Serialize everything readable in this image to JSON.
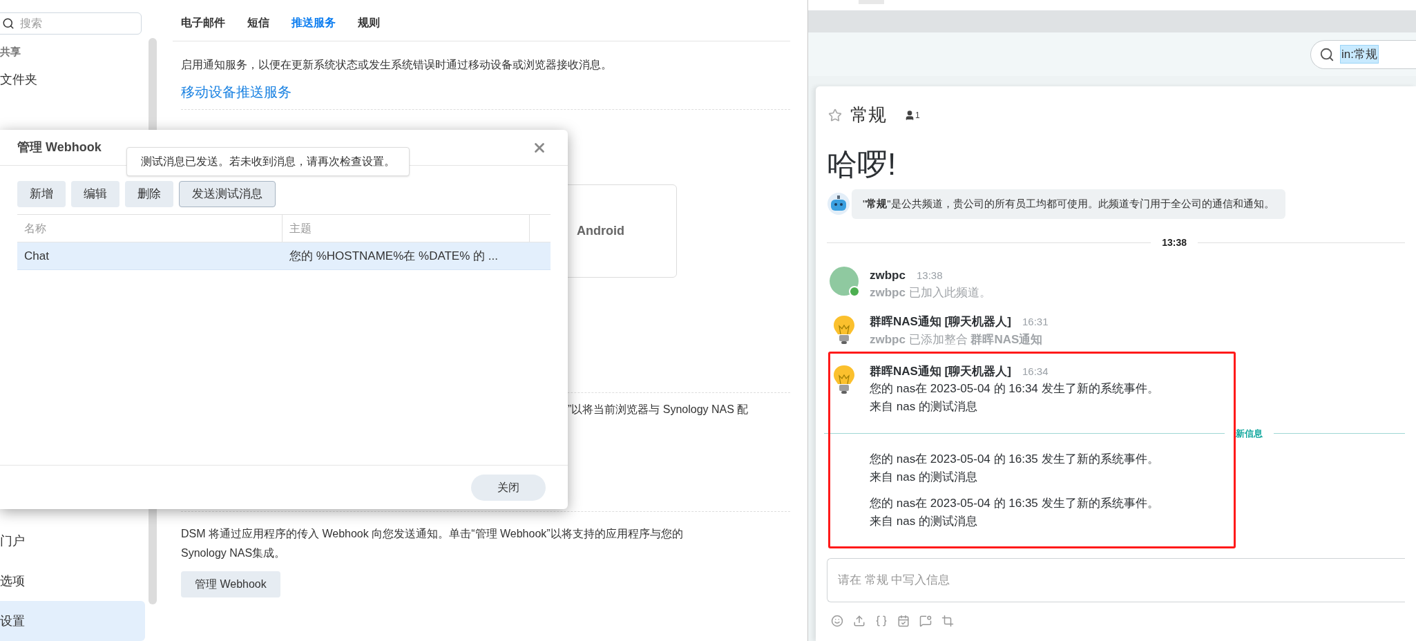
{
  "settings": {
    "search": {
      "placeholder": "搜索"
    },
    "sidebar": {
      "sections": [
        {
          "heading": "共享",
          "items": [
            {
              "label": "文件夹",
              "selected": false
            }
          ]
        },
        {
          "items": [
            {
              "label": "门户",
              "selected": false
            },
            {
              "label": "选项",
              "selected": false
            },
            {
              "label": "设置",
              "selected": true
            }
          ]
        }
      ]
    },
    "tabs": [
      {
        "label": "电子邮件",
        "selected": false
      },
      {
        "label": "短信",
        "selected": false
      },
      {
        "label": "推送服务",
        "selected": true
      },
      {
        "label": "规则",
        "selected": false
      }
    ],
    "description": "启用通知服务，以便在更新系统状态或发生系统错误时通过移动设备或浏览器接收消息。",
    "mobile_link": "移动设备推送服务",
    "android_card": "Android",
    "browser_text_fragment": "”以将当前浏览器与 Synology NAS 配",
    "webhook_text": "DSM 将通过应用程序的传入 Webhook 向您发送通知。单击“管理 Webhook”以将支持的应用程序与您的 Synology NAS集成。",
    "manage_button": "管理 Webhook"
  },
  "dialog": {
    "title": "管理 Webhook",
    "toast": "测试消息已发送。若未收到消息，请再次检查设置。",
    "toolbar": [
      {
        "label": "新增",
        "focused": false
      },
      {
        "label": "编辑",
        "focused": false
      },
      {
        "label": "删除",
        "focused": false
      },
      {
        "label": "发送测试消息",
        "focused": true
      }
    ],
    "table": {
      "columns": [
        "名称",
        "主题"
      ],
      "rows": [
        {
          "cells": [
            "Chat",
            "您的 %HOSTNAME%在 %DATE% 的 ..."
          ],
          "selected": true
        }
      ]
    },
    "close_button": "关闭"
  },
  "chat": {
    "search": {
      "value": "in:常规"
    },
    "channel": {
      "name": "常规",
      "starred": false,
      "member_count": "1"
    },
    "greeting": "哈啰!",
    "intro": "\"**常规**\"是公共频道，贵公司的所有员工均都可使用。此频道专门用于全公司的通信和通知。",
    "timeline": [
      {
        "kind": "divider",
        "label": "13:38"
      },
      {
        "kind": "message",
        "avatar": {
          "kind": "user",
          "online": true
        },
        "author": "zwbpc",
        "time": "13:38",
        "lines": [
          "**zwbpc** 已加入此频道。"
        ],
        "system": true
      },
      {
        "kind": "message",
        "avatar": {
          "kind": "bot"
        },
        "author": "群晖NAS通知 [聊天机器人]",
        "time": "16:31",
        "lines": [
          "**zwbpc** 已添加整合 **群晖NAS通知**"
        ],
        "system": true
      },
      {
        "kind": "message",
        "avatar": {
          "kind": "bot"
        },
        "author": "群晖NAS通知 [聊天机器人]",
        "time": "16:34",
        "lines": [
          "您的 nas在 2023-05-04 的 16:34 发生了新的系统事件。",
          "来自 nas 的测试消息"
        ],
        "system": false,
        "highlighted": true
      },
      {
        "kind": "new_divider",
        "label": "新信息",
        "highlighted": true
      },
      {
        "kind": "continuation",
        "lines": [
          "您的 nas在 2023-05-04 的 16:35 发生了新的系统事件。",
          "来自 nas 的测试消息"
        ],
        "highlighted": true
      },
      {
        "kind": "continuation",
        "lines": [
          "您的 nas在 2023-05-04 的 16:35 发生了新的系统事件。",
          "来自 nas 的测试消息"
        ],
        "highlighted": true
      }
    ],
    "composer": {
      "placeholder": "请在 常规 中写入信息"
    }
  }
}
